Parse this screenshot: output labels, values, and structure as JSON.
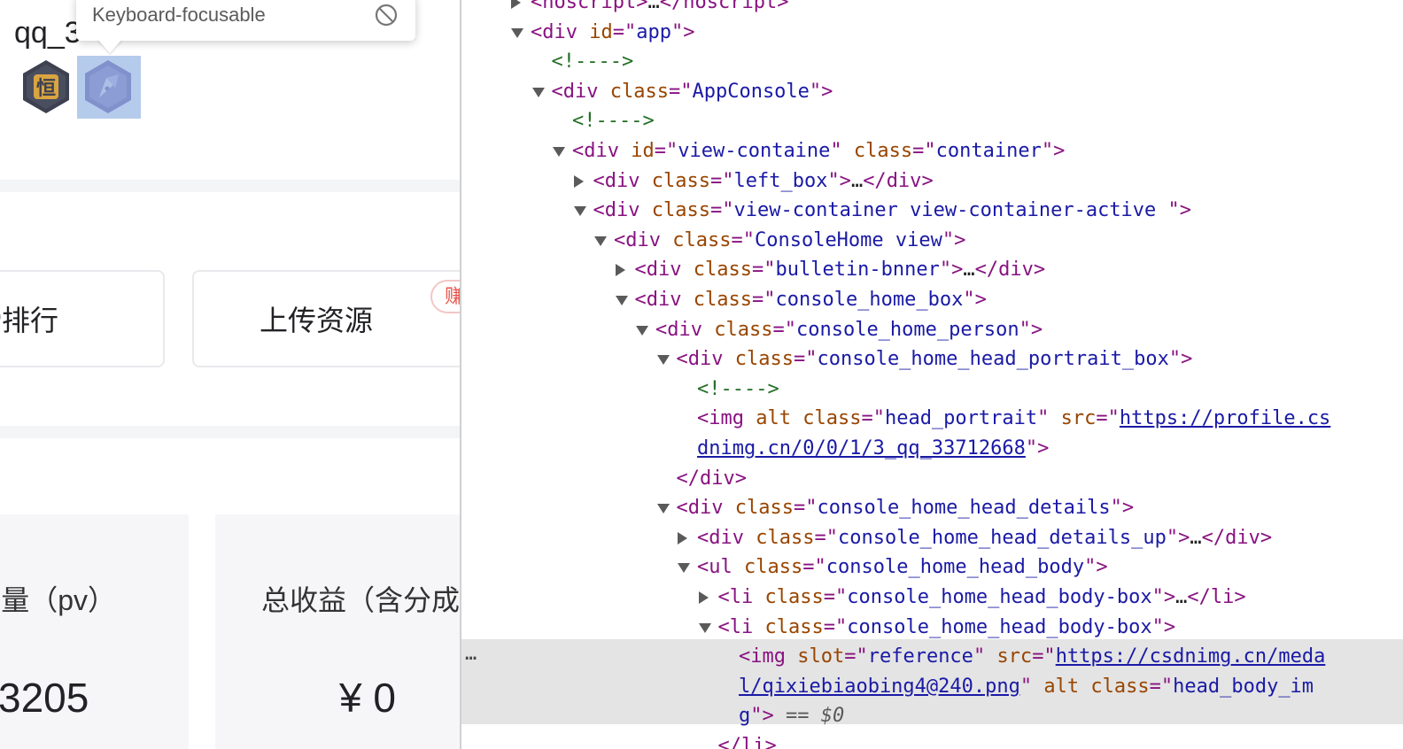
{
  "page": {
    "username_visible": "qq_3",
    "username_masked": "••••",
    "tooltip": {
      "text": "Keyboard-focusable",
      "icon": "no-entry-icon"
    },
    "medals": [
      {
        "name": "medal-heng-icon",
        "glyph": "恒",
        "color": "#3d4150",
        "accent": "#d9a441"
      },
      {
        "name": "medal-pen-icon",
        "color": "#8b7fb8"
      }
    ],
    "actions": [
      {
        "label": "榜排行"
      },
      {
        "label": "上传资源",
        "badge": "赚"
      }
    ],
    "stats": [
      {
        "label": "读量（pv）",
        "value": "3205"
      },
      {
        "label": "总收益（含分成",
        "value": "¥ 0"
      }
    ]
  },
  "devtools": {
    "selected_suffix": " == $0",
    "lines": [
      {
        "indent": 0,
        "toggle": "closed",
        "parts": [
          [
            "punc",
            "<"
          ],
          [
            "tagn",
            "noscript"
          ],
          [
            "punc",
            ">"
          ],
          [
            "ell",
            "…"
          ],
          [
            "punc",
            "</"
          ],
          [
            "tagn",
            "noscript"
          ],
          [
            "punc",
            ">"
          ]
        ]
      },
      {
        "indent": 0,
        "toggle": "open",
        "parts": [
          [
            "punc",
            "<"
          ],
          [
            "tagn",
            "div "
          ],
          [
            "attr",
            "id"
          ],
          [
            "punc",
            "=\""
          ],
          [
            "val",
            "app"
          ],
          [
            "punc",
            "\">"
          ]
        ]
      },
      {
        "indent": 1,
        "toggle": "",
        "parts": [
          [
            "cmt",
            "<!---->"
          ]
        ]
      },
      {
        "indent": 1,
        "toggle": "open",
        "parts": [
          [
            "punc",
            "<"
          ],
          [
            "tagn",
            "div "
          ],
          [
            "attr",
            "class"
          ],
          [
            "punc",
            "=\""
          ],
          [
            "val",
            "AppConsole"
          ],
          [
            "punc",
            "\">"
          ]
        ]
      },
      {
        "indent": 2,
        "toggle": "",
        "parts": [
          [
            "cmt",
            "<!---->"
          ]
        ]
      },
      {
        "indent": 2,
        "toggle": "open",
        "parts": [
          [
            "punc",
            "<"
          ],
          [
            "tagn",
            "div "
          ],
          [
            "attr",
            "id"
          ],
          [
            "punc",
            "=\""
          ],
          [
            "val",
            "view-containe"
          ],
          [
            "punc",
            "\" "
          ],
          [
            "attr",
            "class"
          ],
          [
            "punc",
            "=\""
          ],
          [
            "val",
            "container"
          ],
          [
            "punc",
            "\">"
          ]
        ]
      },
      {
        "indent": 3,
        "toggle": "closed",
        "parts": [
          [
            "punc",
            "<"
          ],
          [
            "tagn",
            "div "
          ],
          [
            "attr",
            "class"
          ],
          [
            "punc",
            "=\""
          ],
          [
            "val",
            "left_box"
          ],
          [
            "punc",
            "\">"
          ],
          [
            "ell",
            "…"
          ],
          [
            "punc",
            "</"
          ],
          [
            "tagn",
            "div"
          ],
          [
            "punc",
            ">"
          ]
        ]
      },
      {
        "indent": 3,
        "toggle": "open",
        "parts": [
          [
            "punc",
            "<"
          ],
          [
            "tagn",
            "div "
          ],
          [
            "attr",
            "class"
          ],
          [
            "punc",
            "=\""
          ],
          [
            "val",
            "view-container view-container-active "
          ],
          [
            "punc",
            "\">"
          ]
        ]
      },
      {
        "indent": 4,
        "toggle": "open",
        "parts": [
          [
            "punc",
            "<"
          ],
          [
            "tagn",
            "div "
          ],
          [
            "attr",
            "class"
          ],
          [
            "punc",
            "=\""
          ],
          [
            "val",
            "ConsoleHome view"
          ],
          [
            "punc",
            "\">"
          ]
        ]
      },
      {
        "indent": 5,
        "toggle": "closed",
        "parts": [
          [
            "punc",
            "<"
          ],
          [
            "tagn",
            "div "
          ],
          [
            "attr",
            "class"
          ],
          [
            "punc",
            "=\""
          ],
          [
            "val",
            "bulletin-bnner"
          ],
          [
            "punc",
            "\">"
          ],
          [
            "ell",
            "…"
          ],
          [
            "punc",
            "</"
          ],
          [
            "tagn",
            "div"
          ],
          [
            "punc",
            ">"
          ]
        ]
      },
      {
        "indent": 5,
        "toggle": "open",
        "parts": [
          [
            "punc",
            "<"
          ],
          [
            "tagn",
            "div "
          ],
          [
            "attr",
            "class"
          ],
          [
            "punc",
            "=\""
          ],
          [
            "val",
            "console_home_box"
          ],
          [
            "punc",
            "\">"
          ]
        ]
      },
      {
        "indent": 6,
        "toggle": "open",
        "parts": [
          [
            "punc",
            "<"
          ],
          [
            "tagn",
            "div "
          ],
          [
            "attr",
            "class"
          ],
          [
            "punc",
            "=\""
          ],
          [
            "val",
            "console_home_person"
          ],
          [
            "punc",
            "\">"
          ]
        ]
      },
      {
        "indent": 7,
        "toggle": "open",
        "parts": [
          [
            "punc",
            "<"
          ],
          [
            "tagn",
            "div "
          ],
          [
            "attr",
            "class"
          ],
          [
            "punc",
            "=\""
          ],
          [
            "val",
            "console_home_head_portrait_box"
          ],
          [
            "punc",
            "\">"
          ]
        ]
      },
      {
        "indent": 8,
        "toggle": "",
        "parts": [
          [
            "cmt",
            "<!---->"
          ]
        ]
      },
      {
        "indent": 8,
        "toggle": "",
        "parts": [
          [
            "punc",
            "<"
          ],
          [
            "tagn",
            "img "
          ],
          [
            "attr",
            "alt class"
          ],
          [
            "punc",
            "=\""
          ],
          [
            "val",
            "head_portrait"
          ],
          [
            "punc",
            "\" "
          ],
          [
            "attr",
            "src"
          ],
          [
            "punc",
            "=\""
          ],
          [
            "link",
            "https://profile.cs"
          ]
        ]
      },
      {
        "indent": 8,
        "toggle": "",
        "parts": [
          [
            "link",
            "dnimg.cn/0/0/1/3_qq_33712668"
          ],
          [
            "punc",
            "\">"
          ]
        ]
      },
      {
        "indent": 7,
        "toggle": "",
        "parts": [
          [
            "punc",
            "</"
          ],
          [
            "tagn",
            "div"
          ],
          [
            "punc",
            ">"
          ]
        ]
      },
      {
        "indent": 7,
        "toggle": "open",
        "parts": [
          [
            "punc",
            "<"
          ],
          [
            "tagn",
            "div "
          ],
          [
            "attr",
            "class"
          ],
          [
            "punc",
            "=\""
          ],
          [
            "val",
            "console_home_head_details"
          ],
          [
            "punc",
            "\">"
          ]
        ]
      },
      {
        "indent": 8,
        "toggle": "closed",
        "parts": [
          [
            "punc",
            "<"
          ],
          [
            "tagn",
            "div "
          ],
          [
            "attr",
            "class"
          ],
          [
            "punc",
            "=\""
          ],
          [
            "val",
            "console_home_head_details_up"
          ],
          [
            "punc",
            "\">"
          ],
          [
            "ell",
            "…"
          ],
          [
            "punc",
            "</"
          ],
          [
            "tagn",
            "div"
          ],
          [
            "punc",
            ">"
          ]
        ]
      },
      {
        "indent": 8,
        "toggle": "open",
        "parts": [
          [
            "punc",
            "<"
          ],
          [
            "tagn",
            "ul "
          ],
          [
            "attr",
            "class"
          ],
          [
            "punc",
            "=\""
          ],
          [
            "val",
            "console_home_head_body"
          ],
          [
            "punc",
            "\">"
          ]
        ]
      },
      {
        "indent": 9,
        "toggle": "closed",
        "parts": [
          [
            "punc",
            "<"
          ],
          [
            "tagn",
            "li "
          ],
          [
            "attr",
            "class"
          ],
          [
            "punc",
            "=\""
          ],
          [
            "val",
            "console_home_head_body-box"
          ],
          [
            "punc",
            "\">"
          ],
          [
            "ell",
            "…"
          ],
          [
            "punc",
            "</"
          ],
          [
            "tagn",
            "li"
          ],
          [
            "punc",
            ">"
          ]
        ]
      },
      {
        "indent": 9,
        "toggle": "open",
        "parts": [
          [
            "punc",
            "<"
          ],
          [
            "tagn",
            "li "
          ],
          [
            "attr",
            "class"
          ],
          [
            "punc",
            "=\""
          ],
          [
            "val",
            "console_home_head_body-box"
          ],
          [
            "punc",
            "\">"
          ]
        ]
      },
      {
        "indent": 10,
        "toggle": "",
        "parts": [
          [
            "punc",
            "<"
          ],
          [
            "tagn",
            "img "
          ],
          [
            "attr",
            "slot"
          ],
          [
            "punc",
            "=\""
          ],
          [
            "val",
            "reference"
          ],
          [
            "punc",
            "\" "
          ],
          [
            "attr",
            "src"
          ],
          [
            "punc",
            "=\""
          ],
          [
            "link",
            "https://csdnimg.cn/meda"
          ]
        ]
      },
      {
        "indent": 10,
        "toggle": "",
        "parts": [
          [
            "link",
            "l/qixiebiaobing4@240.png"
          ],
          [
            "punc",
            "\" "
          ],
          [
            "attr",
            "alt class"
          ],
          [
            "punc",
            "=\""
          ],
          [
            "val",
            "head_body_im"
          ]
        ]
      },
      {
        "indent": 10,
        "toggle": "",
        "selected": true,
        "parts": [
          [
            "val",
            "g"
          ],
          [
            "punc",
            "\">"
          ]
        ]
      },
      {
        "indent": 9,
        "toggle": "",
        "parts": [
          [
            "punc",
            "</"
          ],
          [
            "tagn",
            "li"
          ],
          [
            "punc",
            ">"
          ]
        ]
      }
    ]
  }
}
